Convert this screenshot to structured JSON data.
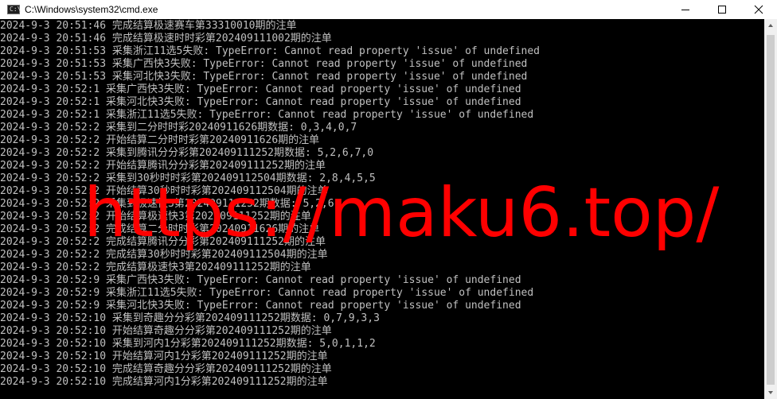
{
  "window": {
    "title": "C:\\Windows\\system32\\cmd.exe",
    "icon_label": "C:\\"
  },
  "controls": {
    "minimize_icon": "minimize-icon",
    "maximize_icon": "maximize-icon",
    "close_icon": "close-icon"
  },
  "console": {
    "lines": [
      "2024-9-3 20:51:46 完成结算极速赛车第33310010期的注单",
      "2024-9-3 20:51:46 完成结算极速时时彩第202409111002期的注单",
      "2024-9-3 20:51:53 采集浙江11选5失败: TypeError: Cannot read property 'issue' of undefined",
      "2024-9-3 20:51:53 采集广西快3失败: TypeError: Cannot read property 'issue' of undefined",
      "2024-9-3 20:51:53 采集河北快3失败: TypeError: Cannot read property 'issue' of undefined",
      "2024-9-3 20:52:1 采集广西快3失败: TypeError: Cannot read property 'issue' of undefined",
      "2024-9-3 20:52:1 采集河北快3失败: TypeError: Cannot read property 'issue' of undefined",
      "2024-9-3 20:52:1 采集浙江11选5失败: TypeError: Cannot read property 'issue' of undefined",
      "2024-9-3 20:52:2 采集到二分时时彩20240911626期数据: 0,3,4,0,7",
      "2024-9-3 20:52:2 开始结算二分时时彩第20240911626期的注单",
      "2024-9-3 20:52:2 采集到腾讯分分彩第202409111252期数据: 5,2,6,7,0",
      "2024-9-3 20:52:2 开始结算腾讯分分彩第202409111252期的注单",
      "2024-9-3 20:52:2 采集到30秒时时彩第202409112504期数据: 2,8,4,5,5",
      "2024-9-3 20:52:2 开始结算30秒时时彩第202409112504期的注单",
      "2024-9-3 20:52:2 采集到极速快3第202409111252期数据: 5,2,6",
      "2024-9-3 20:52:2 开始结算极速快3第202409111252期的注单",
      "2024-9-3 20:52:2 完成结算二分时时彩第20240911626期的注单",
      "2024-9-3 20:52:2 完成结算腾讯分分彩第202409111252期的注单",
      "2024-9-3 20:52:2 完成结算30秒时时彩第202409112504期的注单",
      "2024-9-3 20:52:2 完成结算极速快3第202409111252期的注单",
      "2024-9-3 20:52:9 采集广西快3失败: TypeError: Cannot read property 'issue' of undefined",
      "2024-9-3 20:52:9 采集浙江11选5失败: TypeError: Cannot read property 'issue' of undefined",
      "2024-9-3 20:52:9 采集河北快3失败: TypeError: Cannot read property 'issue' of undefined",
      "2024-9-3 20:52:10 采集到奇趣分分彩第202409111252期数据: 0,7,9,3,3",
      "2024-9-3 20:52:10 开始结算奇趣分分彩第202409111252期的注单",
      "2024-9-3 20:52:10 采集到河内1分彩第202409111252期数据: 5,0,1,1,2",
      "2024-9-3 20:52:10 开始结算河内1分彩第202409111252期的注单",
      "2024-9-3 20:52:10 完成结算奇趣分分彩第202409111252期的注单",
      "2024-9-3 20:52:10 完成结算河内1分彩第202409111252期的注单"
    ]
  },
  "watermark": {
    "text": "https://maku6.top/"
  },
  "scrollbar": {
    "up_icon": "scroll-up-icon",
    "down_icon": "scroll-down-icon"
  },
  "colors": {
    "background": "#000000",
    "text": "#c0c0c0",
    "watermark": "#ff0000",
    "titlebar": "#ffffff"
  }
}
